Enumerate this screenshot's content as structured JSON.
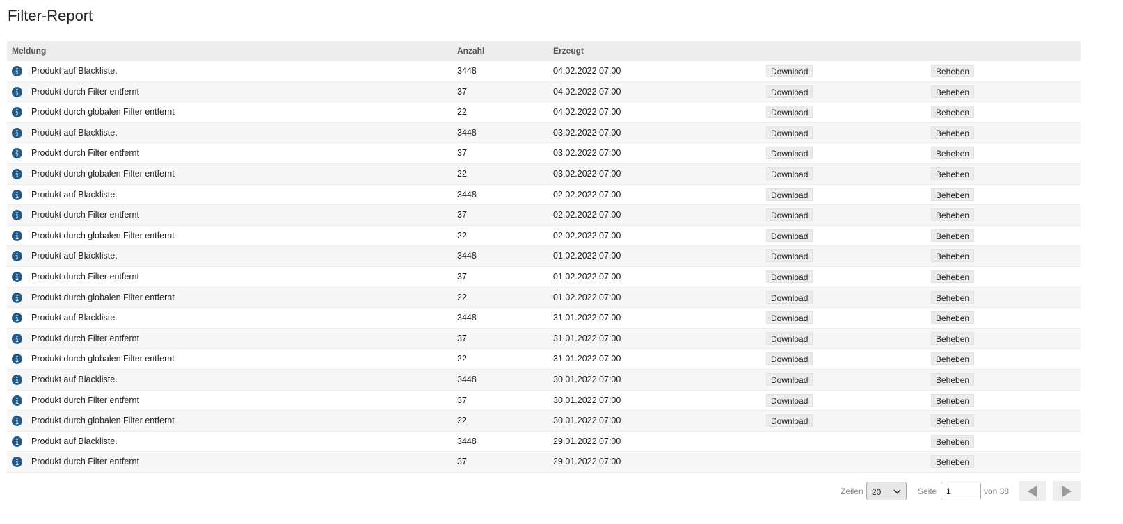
{
  "page": {
    "title": "Filter-Report"
  },
  "table": {
    "headers": {
      "message": "Meldung",
      "count": "Anzahl",
      "created": "Erzeugt"
    },
    "rows": [
      {
        "message": "Produkt auf Blackliste.",
        "count": "3448",
        "created": "04.02.2022 07:00",
        "download": "Download",
        "fix": "Beheben"
      },
      {
        "message": "Produkt durch Filter entfernt",
        "count": "37",
        "created": "04.02.2022 07:00",
        "download": "Download",
        "fix": "Beheben"
      },
      {
        "message": "Produkt durch globalen Filter entfernt",
        "count": "22",
        "created": "04.02.2022 07:00",
        "download": "Download",
        "fix": "Beheben"
      },
      {
        "message": "Produkt auf Blackliste.",
        "count": "3448",
        "created": "03.02.2022 07:00",
        "download": "Download",
        "fix": "Beheben"
      },
      {
        "message": "Produkt durch Filter entfernt",
        "count": "37",
        "created": "03.02.2022 07:00",
        "download": "Download",
        "fix": "Beheben"
      },
      {
        "message": "Produkt durch globalen Filter entfernt",
        "count": "22",
        "created": "03.02.2022 07:00",
        "download": "Download",
        "fix": "Beheben"
      },
      {
        "message": "Produkt auf Blackliste.",
        "count": "3448",
        "created": "02.02.2022 07:00",
        "download": "Download",
        "fix": "Beheben"
      },
      {
        "message": "Produkt durch Filter entfernt",
        "count": "37",
        "created": "02.02.2022 07:00",
        "download": "Download",
        "fix": "Beheben"
      },
      {
        "message": "Produkt durch globalen Filter entfernt",
        "count": "22",
        "created": "02.02.2022 07:00",
        "download": "Download",
        "fix": "Beheben"
      },
      {
        "message": "Produkt auf Blackliste.",
        "count": "3448",
        "created": "01.02.2022 07:00",
        "download": "Download",
        "fix": "Beheben"
      },
      {
        "message": "Produkt durch Filter entfernt",
        "count": "37",
        "created": "01.02.2022 07:00",
        "download": "Download",
        "fix": "Beheben"
      },
      {
        "message": "Produkt durch globalen Filter entfernt",
        "count": "22",
        "created": "01.02.2022 07:00",
        "download": "Download",
        "fix": "Beheben"
      },
      {
        "message": "Produkt auf Blackliste.",
        "count": "3448",
        "created": "31.01.2022 07:00",
        "download": "Download",
        "fix": "Beheben"
      },
      {
        "message": "Produkt durch Filter entfernt",
        "count": "37",
        "created": "31.01.2022 07:00",
        "download": "Download",
        "fix": "Beheben"
      },
      {
        "message": "Produkt durch globalen Filter entfernt",
        "count": "22",
        "created": "31.01.2022 07:00",
        "download": "Download",
        "fix": "Beheben"
      },
      {
        "message": "Produkt auf Blackliste.",
        "count": "3448",
        "created": "30.01.2022 07:00",
        "download": "Download",
        "fix": "Beheben"
      },
      {
        "message": "Produkt durch Filter entfernt",
        "count": "37",
        "created": "30.01.2022 07:00",
        "download": "Download",
        "fix": "Beheben"
      },
      {
        "message": "Produkt durch globalen Filter entfernt",
        "count": "22",
        "created": "30.01.2022 07:00",
        "download": "Download",
        "fix": "Beheben"
      },
      {
        "message": "Produkt auf Blackliste.",
        "count": "3448",
        "created": "29.01.2022 07:00",
        "download": null,
        "fix": "Beheben"
      },
      {
        "message": "Produkt durch Filter entfernt",
        "count": "37",
        "created": "29.01.2022 07:00",
        "download": null,
        "fix": "Beheben"
      }
    ]
  },
  "pagination": {
    "rows_label": "Zeilen",
    "rows_value": "20",
    "page_label": "Seite",
    "page_value": "1",
    "of_label": "von 38"
  },
  "colors": {
    "info_icon": "#1e5a8c",
    "header_bg": "#ededed"
  },
  "icons": {
    "row_icon": "info-icon",
    "prev": "arrow-left-icon",
    "next": "arrow-right-icon"
  }
}
